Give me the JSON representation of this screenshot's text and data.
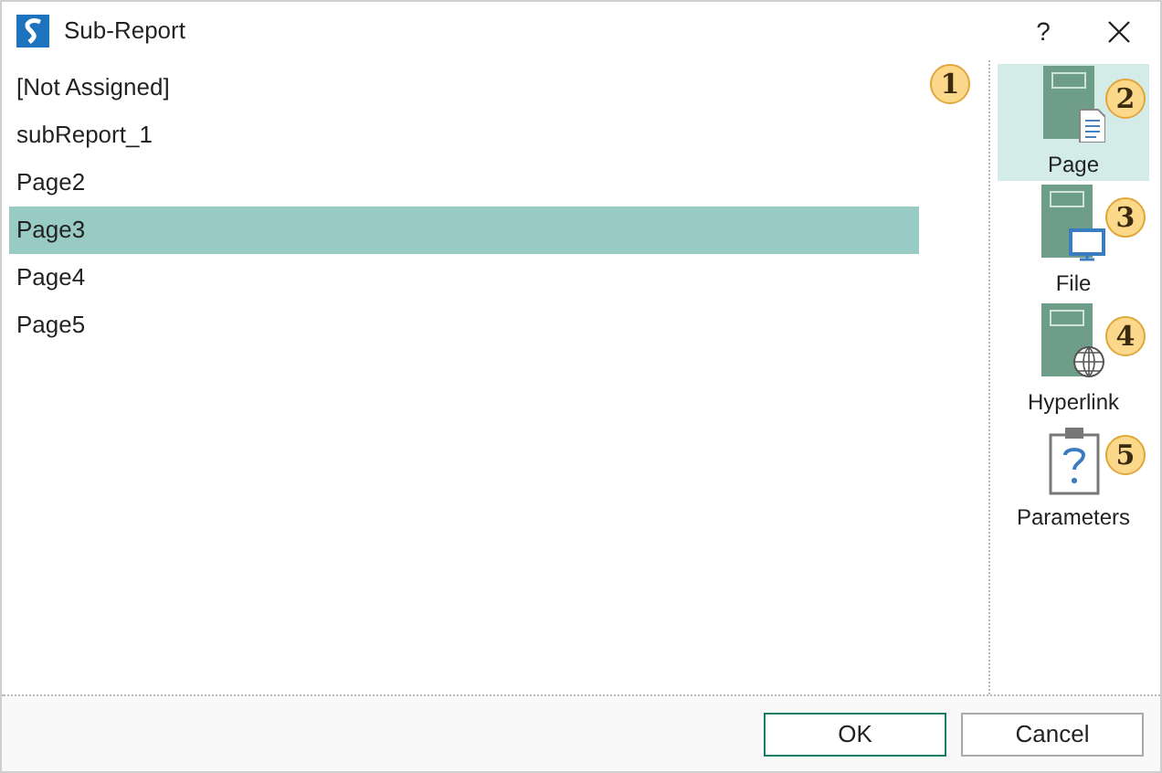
{
  "window": {
    "title": "Sub-Report",
    "help": "?"
  },
  "list": {
    "badge": "1",
    "items": [
      {
        "label": "[Not Assigned]",
        "selected": false
      },
      {
        "label": "subReport_1",
        "selected": false
      },
      {
        "label": "Page2",
        "selected": false
      },
      {
        "label": "Page3",
        "selected": true
      },
      {
        "label": "Page4",
        "selected": false
      },
      {
        "label": "Page5",
        "selected": false
      }
    ]
  },
  "sources": [
    {
      "kind": "page",
      "label": "Page",
      "badge": "2",
      "selected": true
    },
    {
      "kind": "file",
      "label": "File",
      "badge": "3",
      "selected": false
    },
    {
      "kind": "hyperlink",
      "label": "Hyperlink",
      "badge": "4",
      "selected": false
    },
    {
      "kind": "parameters",
      "label": "Parameters",
      "badge": "5",
      "selected": false
    }
  ],
  "buttons": [
    {
      "label": "OK",
      "kind": "primary"
    },
    {
      "label": "Cancel",
      "kind": "secondary"
    }
  ]
}
